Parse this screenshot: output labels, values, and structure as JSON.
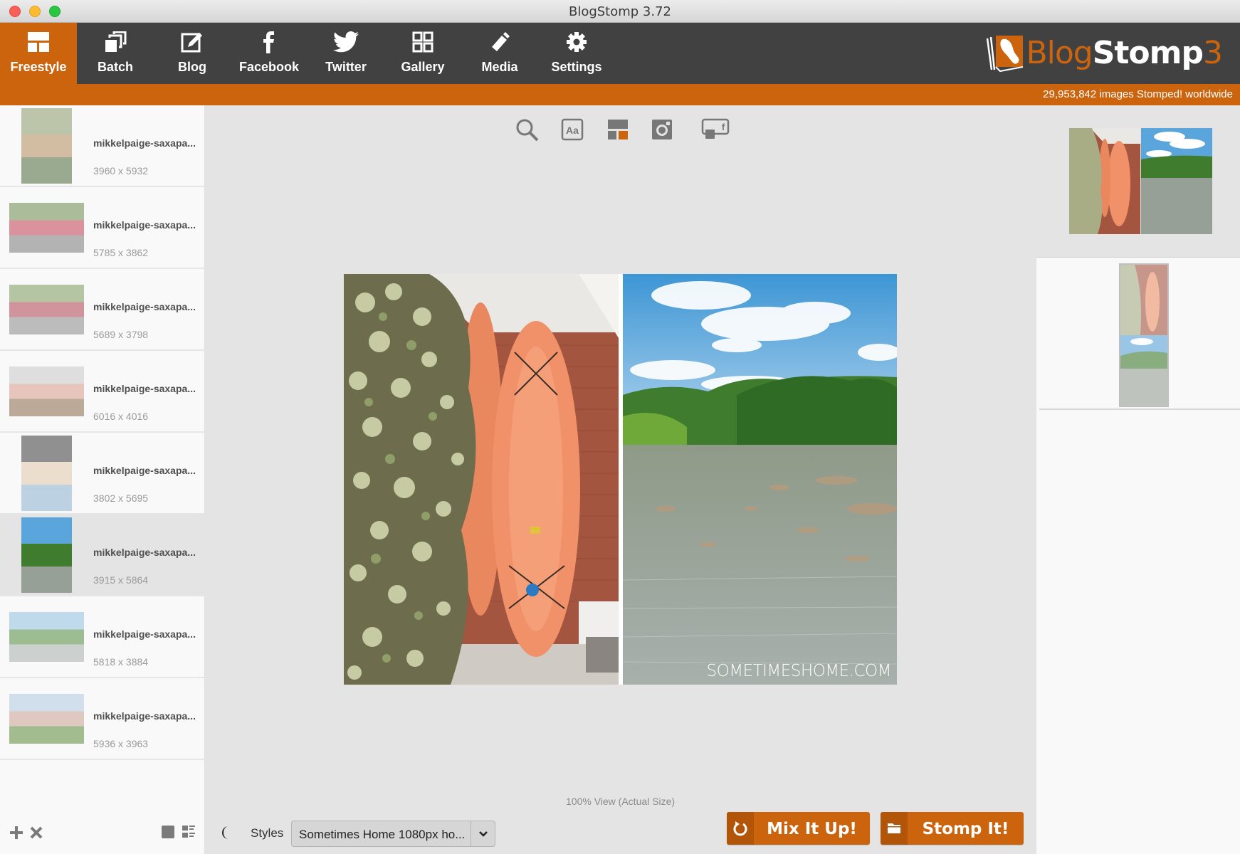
{
  "window": {
    "title": "BlogStomp 3.72"
  },
  "nav": {
    "items": [
      {
        "label": "Freestyle",
        "icon": "freestyle-layout-icon",
        "active": true
      },
      {
        "label": "Batch",
        "icon": "batch-stack-icon",
        "active": false
      },
      {
        "label": "Blog",
        "icon": "blog-edit-icon",
        "active": false
      },
      {
        "label": "Facebook",
        "icon": "facebook-icon",
        "active": false
      },
      {
        "label": "Twitter",
        "icon": "twitter-bird-icon",
        "active": false
      },
      {
        "label": "Gallery",
        "icon": "gallery-grid-icon",
        "active": false
      },
      {
        "label": "Media",
        "icon": "usb-drive-icon",
        "active": false
      },
      {
        "label": "Settings",
        "icon": "gear-icon",
        "active": false
      }
    ],
    "logo": {
      "part1": "Blog",
      "part2": "Stomp",
      "part3": "3"
    },
    "stomp_count": "29,953,842 images Stomped! worldwide"
  },
  "colors": {
    "accent": "#cc640e",
    "nav_bg": "#414141",
    "canvas_bg": "#e4e4e4",
    "sidebar_bg": "#f9f9f9"
  },
  "sidebar": {
    "files": [
      {
        "name": "mikkelpaige-saxapa...",
        "dims": "3960 x 5932",
        "orientation": "portrait",
        "selected": false
      },
      {
        "name": "mikkelpaige-saxapa...",
        "dims": "5785 x 3862",
        "orientation": "landscape",
        "selected": false
      },
      {
        "name": "mikkelpaige-saxapa...",
        "dims": "5689 x 3798",
        "orientation": "landscape",
        "selected": false
      },
      {
        "name": "mikkelpaige-saxapa...",
        "dims": "6016 x 4016",
        "orientation": "landscape",
        "selected": false
      },
      {
        "name": "mikkelpaige-saxapa...",
        "dims": "3802 x 5695",
        "orientation": "portrait",
        "selected": false
      },
      {
        "name": "mikkelpaige-saxapa...",
        "dims": "3915 x 5864",
        "orientation": "portrait",
        "selected": true
      },
      {
        "name": "mikkelpaige-saxapa...",
        "dims": "5818 x 3884",
        "orientation": "landscape",
        "selected": false
      },
      {
        "name": "mikkelpaige-saxapa...",
        "dims": "5936 x 3963",
        "orientation": "landscape",
        "selected": false
      }
    ],
    "footer": {
      "add": "+",
      "remove": "✕"
    }
  },
  "canvas": {
    "tools": [
      "zoom-icon",
      "text-style-icon",
      "layout-icon",
      "instagram-icon",
      "facebook-cover-icon"
    ],
    "watermark": "SOMETIMESHOME.COM",
    "view_label": "100% View (Actual Size)"
  },
  "bottom": {
    "styles_label": "Styles",
    "styles_value": "Sometimes Home 1080px ho...",
    "mix_label": "Mix It Up!",
    "stomp_label": "Stomp It!"
  }
}
